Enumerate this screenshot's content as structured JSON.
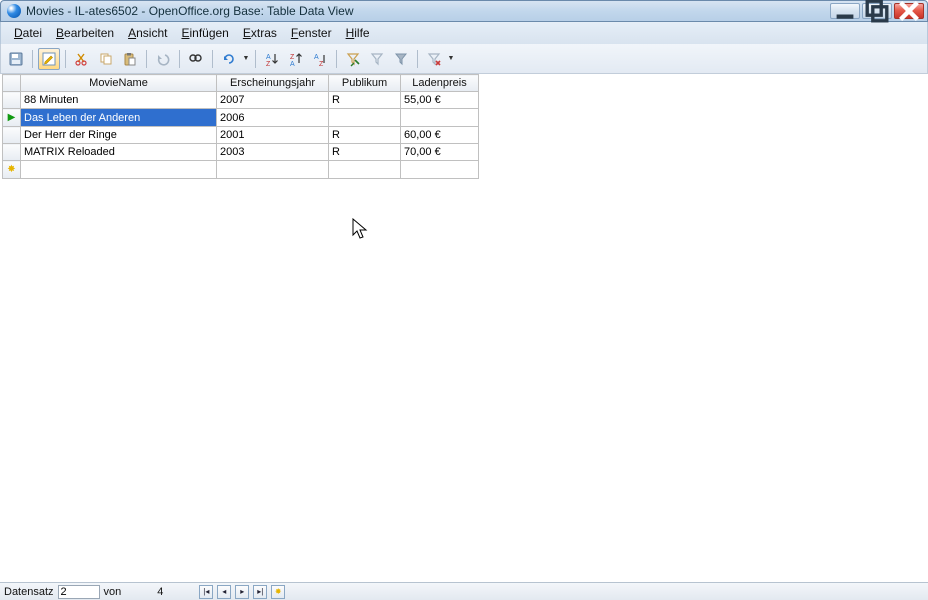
{
  "window": {
    "title": "Movies - IL-ates6502 - OpenOffice.org Base: Table Data View"
  },
  "menu": {
    "items": [
      {
        "mn": "D",
        "rest": "atei"
      },
      {
        "mn": "B",
        "rest": "earbeiten"
      },
      {
        "mn": "A",
        "rest": "nsicht"
      },
      {
        "mn": "E",
        "rest": "infügen"
      },
      {
        "mn": "E",
        "rest": "xtras"
      },
      {
        "mn": "F",
        "rest": "enster"
      },
      {
        "mn": "H",
        "rest": "ilfe"
      }
    ]
  },
  "table": {
    "columns": [
      "MovieName",
      "Erscheinungsjahr",
      "Publikum",
      "Ladenpreis"
    ],
    "rows": [
      {
        "name": "88 Minuten",
        "year": "2007",
        "pub": "R",
        "price": "55,00 €",
        "marker": ""
      },
      {
        "name": "Das Leben der Anderen",
        "year": "2006",
        "pub": "",
        "price": "",
        "marker": "current",
        "selected": true
      },
      {
        "name": "Der Herr der Ringe",
        "year": "2001",
        "pub": "R",
        "price": "60,00 €",
        "marker": ""
      },
      {
        "name": "MATRIX Reloaded",
        "year": "2003",
        "pub": "R",
        "price": "70,00 €",
        "marker": ""
      }
    ]
  },
  "status": {
    "record_label": "Datensatz",
    "current": "2",
    "of_label": "von",
    "total": "4"
  }
}
